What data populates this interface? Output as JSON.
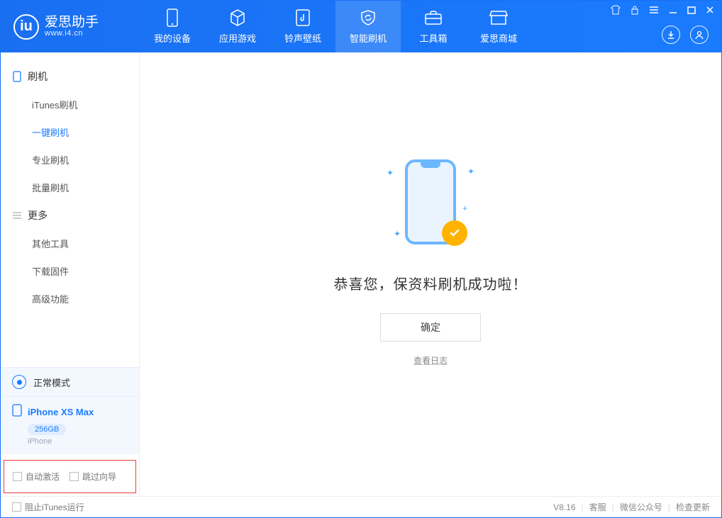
{
  "app": {
    "title": "爱思助手",
    "url": "www.i4.cn"
  },
  "nav": {
    "items": [
      {
        "label": "我的设备"
      },
      {
        "label": "应用游戏"
      },
      {
        "label": "铃声壁纸"
      },
      {
        "label": "智能刷机"
      },
      {
        "label": "工具箱"
      },
      {
        "label": "爱思商城"
      }
    ],
    "active_index": 3
  },
  "sidebar": {
    "sections": [
      {
        "title": "刷机",
        "items": [
          "iTunes刷机",
          "一键刷机",
          "专业刷机",
          "批量刷机"
        ],
        "active_index": 1
      },
      {
        "title": "更多",
        "items": [
          "其他工具",
          "下载固件",
          "高级功能"
        ],
        "active_index": -1
      }
    ],
    "mode": "正常模式",
    "device": {
      "name": "iPhone XS Max",
      "capacity": "256GB",
      "type": "iPhone"
    },
    "checks": {
      "auto_activate": "自动激活",
      "skip_guide": "跳过向导"
    }
  },
  "main": {
    "result_title": "恭喜您，保资料刷机成功啦！",
    "ok_label": "确定",
    "log_link": "查看日志"
  },
  "footer": {
    "block_itunes": "阻止iTunes运行",
    "version": "V8.16",
    "links": [
      "客服",
      "微信公众号",
      "检查更新"
    ]
  }
}
